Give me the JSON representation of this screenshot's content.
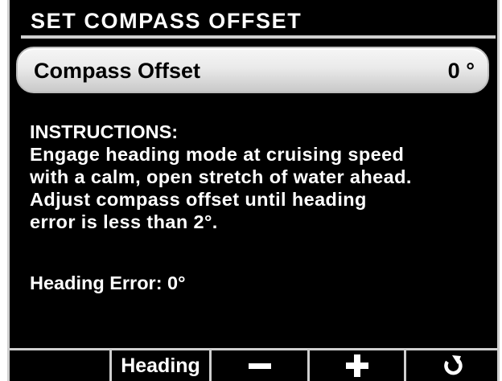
{
  "screen": {
    "title": "SET COMPASS OFFSET"
  },
  "field": {
    "label": "Compass Offset",
    "value": "0 °"
  },
  "instructions": {
    "heading": "INSTRUCTIONS:",
    "lines": [
      "Engage heading mode at cruising speed",
      "with a calm, open stretch of water ahead.",
      "Adjust compass offset until heading",
      "error is less than 2°."
    ]
  },
  "status": {
    "heading_error": "Heading Error:  0°"
  },
  "softkeys": [
    {
      "label": "",
      "icon": ""
    },
    {
      "label": "Heading",
      "icon": ""
    },
    {
      "label": "",
      "icon": "minus-icon"
    },
    {
      "label": "",
      "icon": "plus-icon"
    },
    {
      "label": "",
      "icon": "rotate-back-icon"
    }
  ],
  "colors": {
    "background": "#000000",
    "text": "#ffffff",
    "frame": "#cfcfcf",
    "field_light": "#f0f0f0",
    "field_dark": "#c9c9c9"
  }
}
